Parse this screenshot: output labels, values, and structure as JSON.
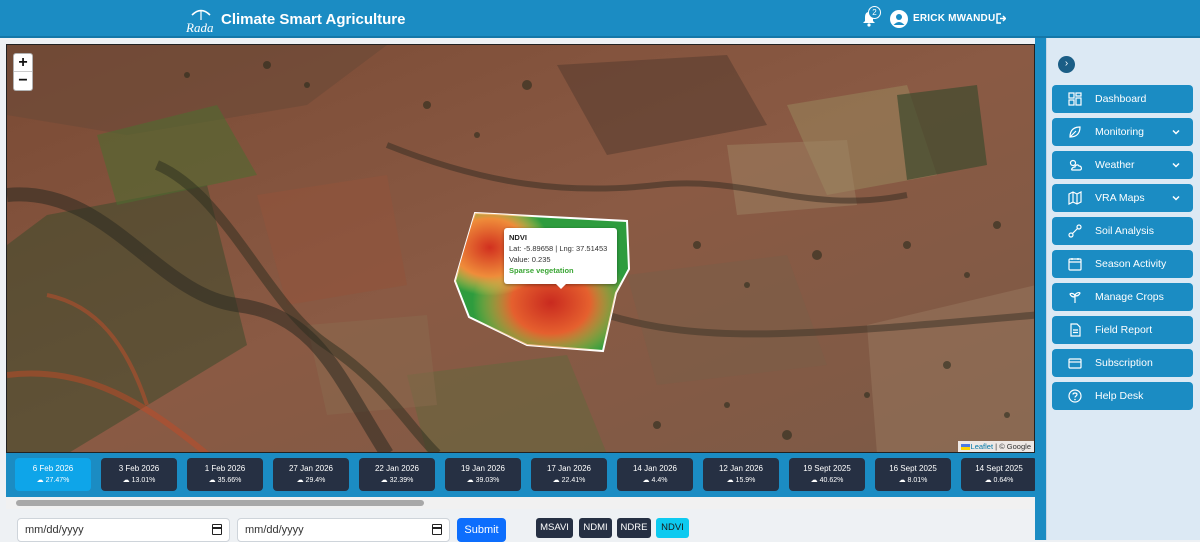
{
  "header": {
    "logo_text": "Rada",
    "title": "Climate Smart Agriculture",
    "notification_count": "2",
    "user_name": "ERICK MWANDU"
  },
  "map": {
    "zoom_in": "+",
    "zoom_out": "−",
    "attribution_leaflet": "Leaflet",
    "attribution_rest": " | © Google",
    "tooltip": {
      "title": "NDVI",
      "coords": "Lat: -5.89658 | Lng: 37.51453",
      "value": "Value: 0.235",
      "status": "Sparse vegetation"
    }
  },
  "dates": [
    {
      "date": "6 Feb 2026",
      "cloud": "27.47%",
      "active": true
    },
    {
      "date": "3 Feb 2026",
      "cloud": "13.01%"
    },
    {
      "date": "1 Feb 2026",
      "cloud": "35.66%"
    },
    {
      "date": "27 Jan 2026",
      "cloud": "29.4%"
    },
    {
      "date": "22 Jan 2026",
      "cloud": "32.39%"
    },
    {
      "date": "19 Jan 2026",
      "cloud": "39.03%"
    },
    {
      "date": "17 Jan 2026",
      "cloud": "22.41%"
    },
    {
      "date": "14 Jan 2026",
      "cloud": "4.4%"
    },
    {
      "date": "12 Jan 2026",
      "cloud": "15.9%"
    },
    {
      "date": "19 Sept 2025",
      "cloud": "40.62%"
    },
    {
      "date": "16 Sept 2025",
      "cloud": "8.01%"
    },
    {
      "date": "14 Sept 2025",
      "cloud": "0.64%"
    }
  ],
  "filters": {
    "start_date_placeholder": "mm/dd/yyyy",
    "end_date_placeholder": "mm/dd/yyyy",
    "submit_label": "Submit"
  },
  "indices": [
    "MSAVI",
    "NDMI",
    "NDRE",
    "NDVI"
  ],
  "active_index": "NDVI",
  "sidebar": {
    "items": [
      {
        "label": "Dashboard",
        "icon": "dashboard-icon",
        "expandable": false
      },
      {
        "label": "Monitoring",
        "icon": "leaf-icon",
        "expandable": true
      },
      {
        "label": "Weather",
        "icon": "weather-icon",
        "expandable": true
      },
      {
        "label": "VRA Maps",
        "icon": "map-icon",
        "expandable": true
      },
      {
        "label": "Soil Analysis",
        "icon": "soil-icon",
        "expandable": false
      },
      {
        "label": "Season Activity",
        "icon": "calendar-icon",
        "expandable": false
      },
      {
        "label": "Manage Crops",
        "icon": "sprout-icon",
        "expandable": false
      },
      {
        "label": "Field Report",
        "icon": "report-icon",
        "expandable": false
      },
      {
        "label": "Subscription",
        "icon": "card-icon",
        "expandable": false
      },
      {
        "label": "Help Desk",
        "icon": "help-icon",
        "expandable": false
      }
    ]
  },
  "colors": {
    "header": "#1b8cc3",
    "date_card": "#263043",
    "date_card_active": "#0ea5e9",
    "submit": "#0d6efd",
    "index_active": "#0dcaf0"
  }
}
